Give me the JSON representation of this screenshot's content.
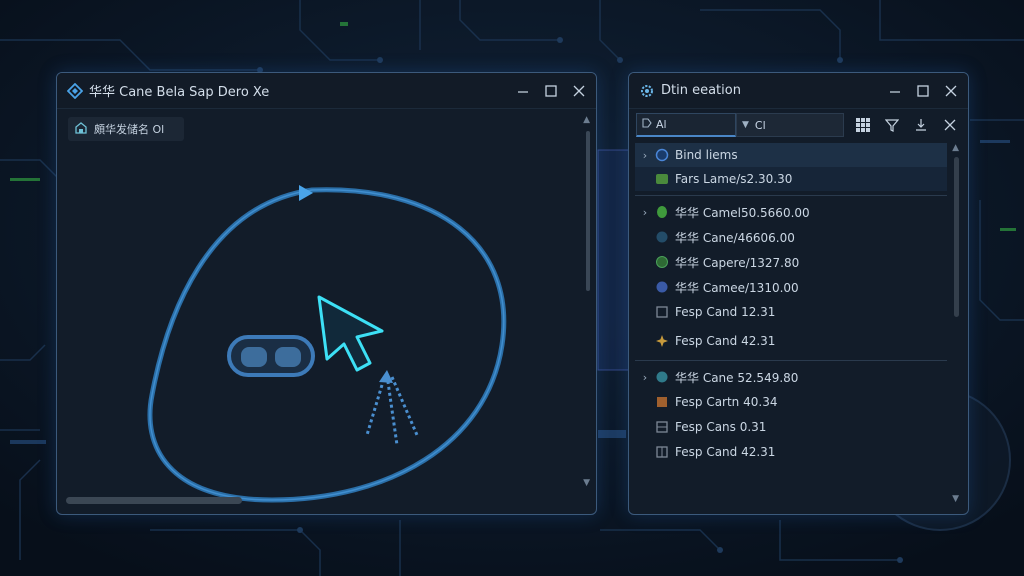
{
  "colors": {
    "background": "#0a1422",
    "window_bg": "#121c29",
    "window_border": "#3c5a7c",
    "accent_blue": "#3a8fd8",
    "accent_cyan": "#38d0f0",
    "selection": "#1d3046"
  },
  "left_window": {
    "title": "华华 Cane Bela Sap Dero Xe",
    "title_icon": "diamond-logo-icon",
    "toolbar_chip_label": "頗华发储名 Ol",
    "toolbar_chip_icon": "house-icon",
    "controls": [
      "minimize-icon",
      "maximize-icon",
      "close-icon"
    ]
  },
  "right_window": {
    "title": "Dtin eeation",
    "title_icon": "gear-logo-icon",
    "search_value": "Al",
    "select_value": "Cl",
    "tools": [
      "grid-icon",
      "filter-icon",
      "download-icon",
      "close-icon"
    ],
    "rows": [
      {
        "label": "Bind liems",
        "expandable": true,
        "icon": "circle-icon",
        "icon_color": "#3b6fc7",
        "state": "selected"
      },
      {
        "label": "Fars Lame/s2.30.30",
        "expandable": false,
        "icon": "square-icon",
        "icon_color": "#5aa04a",
        "state": "hover"
      },
      {
        "label": "华华 Camel50.5660.00",
        "expandable": true,
        "icon": "leaf-icon",
        "icon_color": "#3f9a3c",
        "state": ""
      },
      {
        "label": "华华 Cane/46606.00",
        "expandable": false,
        "icon": "circle-icon",
        "icon_color": "#2e6b8a",
        "state": ""
      },
      {
        "label": "华华 Capere/1327.80",
        "expandable": false,
        "icon": "circle-icon",
        "icon_color": "#3c8a3c",
        "state": ""
      },
      {
        "label": "华华 Camee/1310.00",
        "expandable": false,
        "icon": "circle-icon",
        "icon_color": "#3a5aa6",
        "state": ""
      },
      {
        "label": "Fesp Cand 12.31",
        "expandable": false,
        "icon": "square-icon",
        "icon_color": "#5a6472",
        "state": ""
      },
      {
        "label": "Fesp Cand 42.31",
        "expandable": false,
        "icon": "star-icon",
        "icon_color": "#c79a3c",
        "state": ""
      },
      {
        "label": "华华 Cane 52.549.80",
        "expandable": true,
        "icon": "circle-icon",
        "icon_color": "#2f7a8a",
        "state": ""
      },
      {
        "label": "Fesp Cartn 40.34",
        "expandable": false,
        "icon": "square-icon",
        "icon_color": "#a0602e",
        "state": ""
      },
      {
        "label": "Fesp Cans 0.31",
        "expandable": false,
        "icon": "square-icon",
        "icon_color": "#5a6472",
        "state": ""
      },
      {
        "label": "Fesp Cand 42.31",
        "expandable": false,
        "icon": "square-icon",
        "icon_color": "#5a6472",
        "state": ""
      }
    ]
  }
}
